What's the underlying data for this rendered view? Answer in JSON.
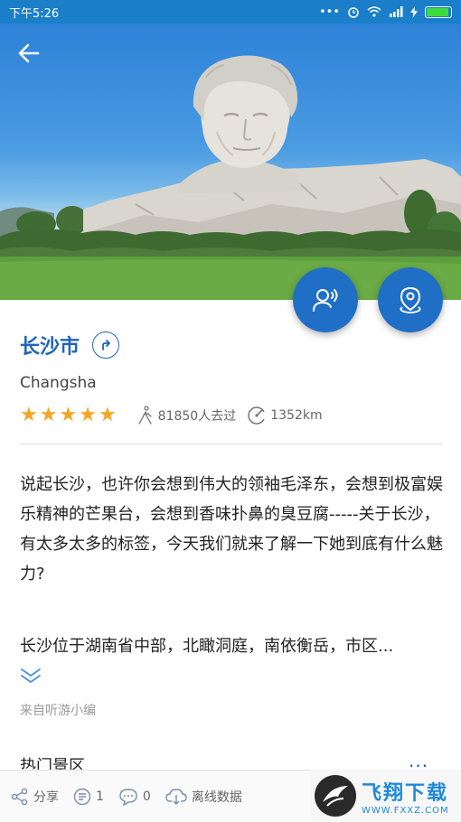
{
  "status_bar": {
    "time": "下午5:26",
    "battery_level": 0.85
  },
  "hero": {
    "back_icon": "arrow-left-icon",
    "fab_guide_icon": "audio-guide-icon",
    "fab_location_icon": "location-pin-icon"
  },
  "city": {
    "name": "长沙市",
    "english_name": "Changsha",
    "rating_stars": 5,
    "visitors": "81850人去过",
    "distance": "1352km"
  },
  "intro": {
    "paragraph1": "说起长沙，也许你会想到伟大的领袖毛泽东，会想到极富娱乐精神的芒果台，会想到香味扑鼻的臭豆腐-----关于长沙，有太多太多的标签，今天我们就来了解一下她到底有什么魅力?",
    "paragraph2": "长沙位于湖南省中部，北瞰洞庭，南依衡岳，市区...",
    "source": "来自听游小编"
  },
  "section": {
    "title": "热门景区",
    "more": "···"
  },
  "bottom_bar": {
    "share": "分享",
    "list_count": "1",
    "comment_count": "0",
    "offline": "离线数据"
  },
  "watermark": {
    "text": "飞翔下载",
    "url": "WWW.FXXZ.COM"
  },
  "colors": {
    "accent": "#1f64b8",
    "fab": "#1f6fc6",
    "status_bar": "#1a7fc8",
    "star": "#f5a623"
  }
}
